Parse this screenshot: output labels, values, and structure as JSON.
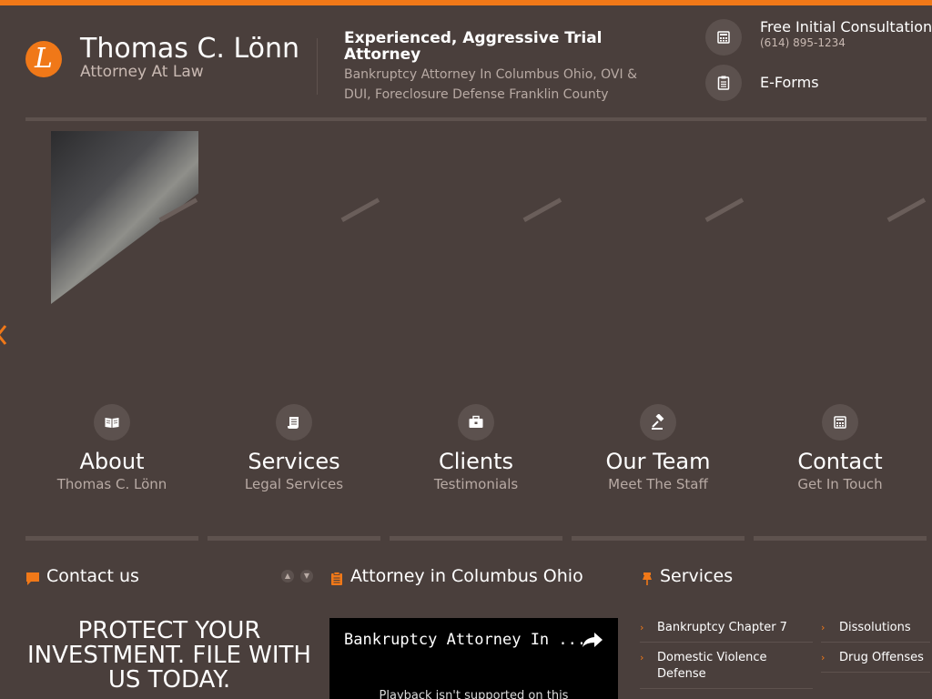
{
  "header": {
    "logo_letter": "L",
    "title": "Thomas C. Lönn",
    "subtitle": "Attorney At Law",
    "tagline_title": "Experienced, Aggressive Trial Attorney",
    "tagline_desc": "Bankruptcy Attorney In Columbus Ohio, OVI & DUI, Foreclosure Defense Franklin County",
    "consultation_label": "Free Initial Consultation",
    "consultation_phone": "(614) 895-1234",
    "eforms_label": "E-Forms"
  },
  "slider": {
    "tiles": [
      "suit-tie-photo",
      "fountain-pen-photo",
      "documents-photo",
      "wristwatch-photo",
      "smartphone-photo"
    ]
  },
  "nav": {
    "items": [
      {
        "title": "About",
        "sub": "Thomas C. Lönn",
        "icon": "book-icon"
      },
      {
        "title": "Services",
        "sub": "Legal Services",
        "icon": "scroll-icon"
      },
      {
        "title": "Clients",
        "sub": "Testimonials",
        "icon": "briefcase-icon"
      },
      {
        "title": "Our Team",
        "sub": "Meet The Staff",
        "icon": "gavel-icon"
      },
      {
        "title": "Contact",
        "sub": "Get In Touch",
        "icon": "phone-icon"
      }
    ]
  },
  "contact": {
    "heading": "Contact us",
    "promo": "PROTECT YOUR INVESTMENT. FILE WITH US TODAY."
  },
  "video": {
    "heading": "Attorney in Columbus Ohio",
    "title": "Bankruptcy Attorney In ...",
    "message": "Playback isn't supported on this"
  },
  "services": {
    "heading": "Services",
    "col1": [
      "Bankruptcy Chapter 7",
      "Domestic Violence Defense"
    ],
    "col2": [
      "Dissolutions",
      "Drug Offenses"
    ]
  },
  "colors": {
    "accent": "#f07818",
    "background": "#4a3f3c",
    "panel": "#5c514e"
  }
}
